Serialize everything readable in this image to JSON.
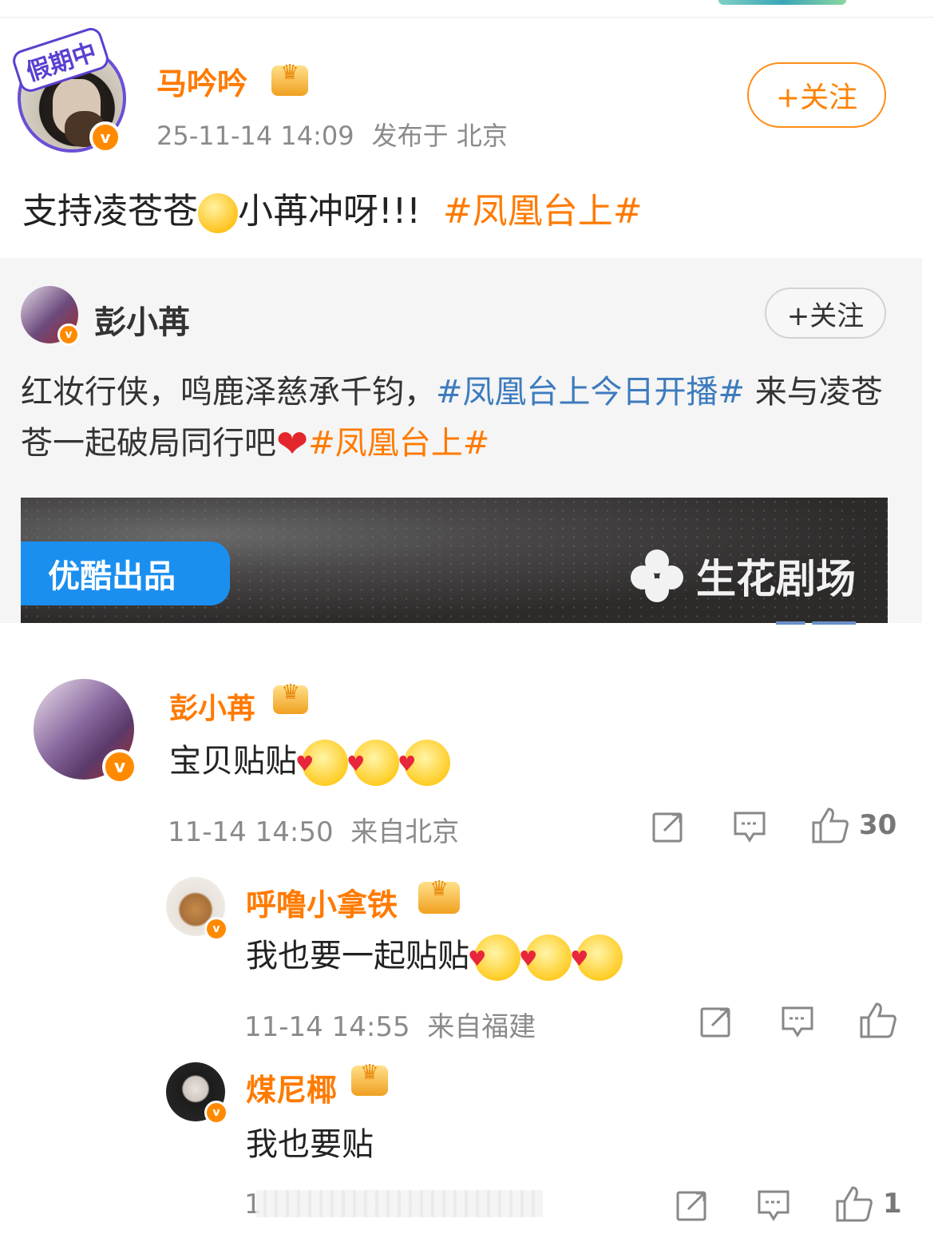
{
  "post": {
    "author": "马吟吟",
    "avatar_sticker": "假期中",
    "timestamp": "25-11-14 14:09",
    "location": "发布于 北京",
    "follow_label": "+关注",
    "text_before_emoji": "支持凌苍苍",
    "text_after_emoji": "小苒冲呀!!!",
    "topic": "#凤凰台上#"
  },
  "repost": {
    "author": "彭小苒",
    "follow_label": "+关注",
    "text_part1": "红妆行侠，鸣鹿泽慈承千钧，",
    "topic_blue": "#凤凰台上今日开播#",
    "text_part2": " 来与凌苍苍一起破局同行吧",
    "topic_orange": "#凤凰台上#",
    "banner_left_tag": "优酷出品",
    "banner_right_brand": "生花剧场"
  },
  "comments": [
    {
      "author": "彭小苒",
      "text": "宝贝贴贴",
      "time": "11-14 14:50",
      "location": "来自北京",
      "likes": "30"
    },
    {
      "author": "呼噜小拿铁",
      "text": "我也要一起贴贴",
      "time": "11-14 14:55",
      "location": "来自福建",
      "likes": ""
    },
    {
      "author": "煤尼椰",
      "text": "我也要贴",
      "time": "1",
      "location": "",
      "likes": "1"
    }
  ],
  "colors": {
    "accent_orange": "#ff7a00",
    "topic_blue": "#3d7bbd",
    "verified_badge": "#ff8a00",
    "youku_blue": "#1b8ff0"
  },
  "icons": [
    "verified-badge-icon",
    "crown-badge-icon",
    "repost-icon",
    "comment-icon",
    "like-icon",
    "kiss-emoji-icon",
    "heart-emoji-icon",
    "flower-logo-icon"
  ]
}
